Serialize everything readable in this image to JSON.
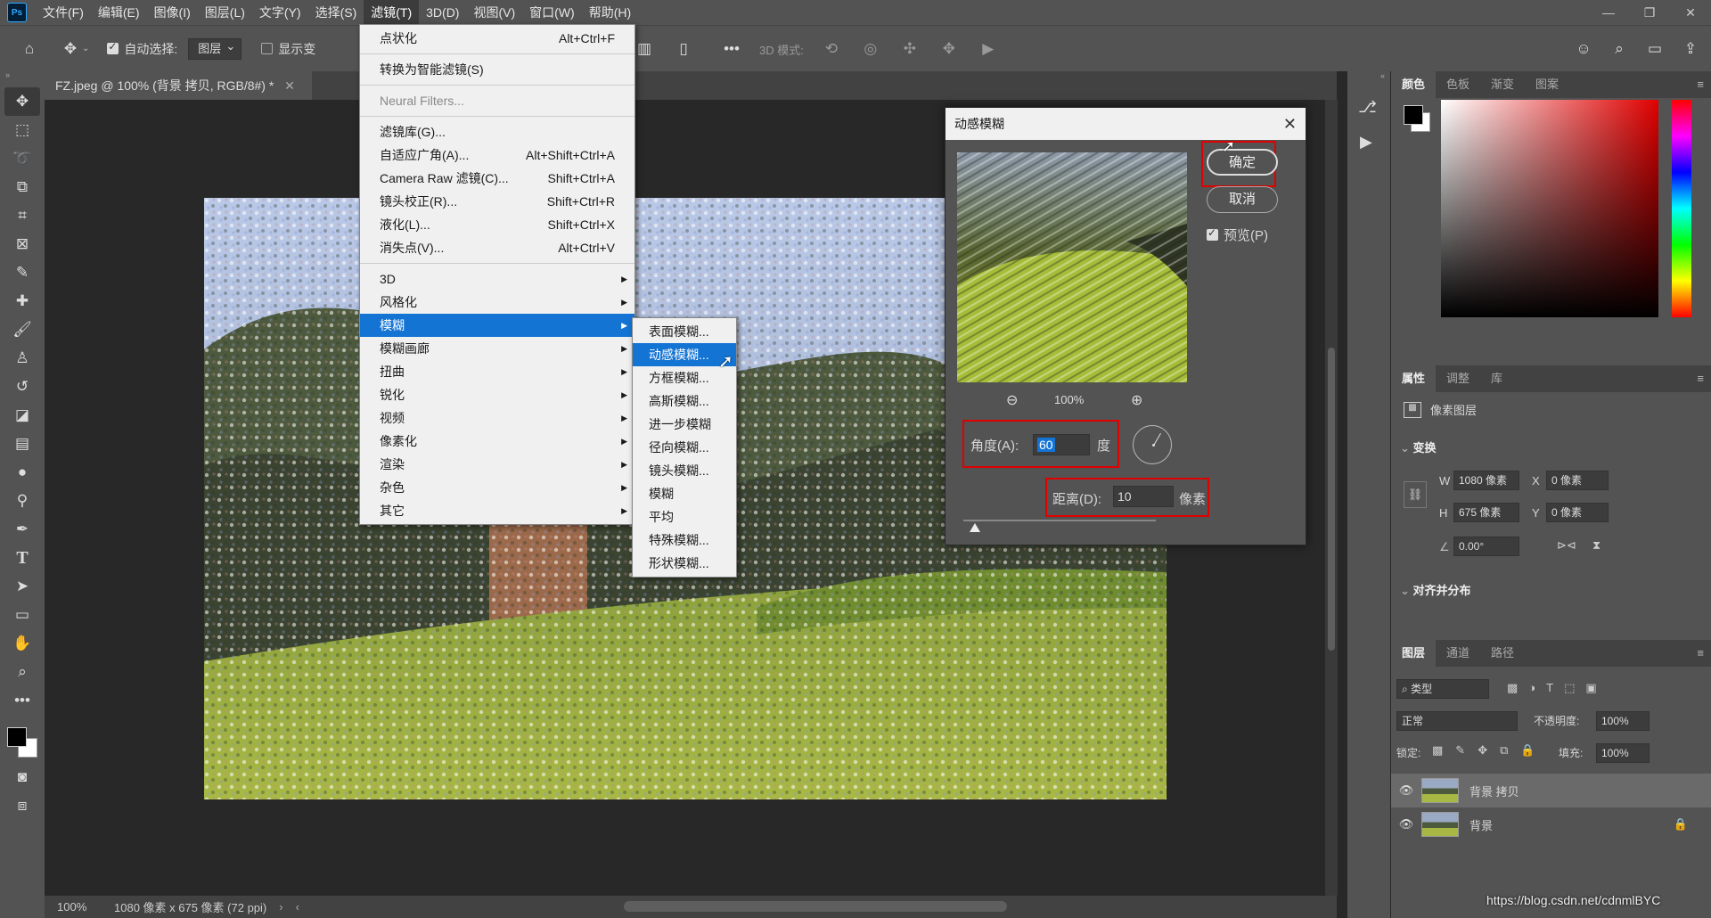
{
  "menubar": {
    "logo": "Ps",
    "items": [
      "文件(F)",
      "编辑(E)",
      "图像(I)",
      "图层(L)",
      "文字(Y)",
      "选择(S)",
      "滤镜(T)",
      "3D(D)",
      "视图(V)",
      "窗口(W)",
      "帮助(H)"
    ],
    "active_index": 6
  },
  "options_bar": {
    "auto_select_label": "自动选择:",
    "auto_select_value": "图层",
    "show_transform_label": "显示变",
    "mode_3d_label": "3D 模式:"
  },
  "document": {
    "tab_title": "FZ.jpeg @ 100% (背景 拷贝, RGB/8#) *",
    "zoom": "100%",
    "size_info": "1080 像素 x 675 像素 (72 ppi)"
  },
  "filter_menu": {
    "items": [
      {
        "label": "点状化",
        "shortcut": "Alt+Ctrl+F"
      },
      {
        "sep": true
      },
      {
        "label": "转换为智能滤镜(S)",
        "shortcut": ""
      },
      {
        "sep": true
      },
      {
        "label": "Neural Filters...",
        "shortcut": "",
        "disabled": true
      },
      {
        "sep": true
      },
      {
        "label": "滤镜库(G)...",
        "shortcut": ""
      },
      {
        "label": "自适应广角(A)...",
        "shortcut": "Alt+Shift+Ctrl+A"
      },
      {
        "label": "Camera Raw 滤镜(C)...",
        "shortcut": "Shift+Ctrl+A"
      },
      {
        "label": "镜头校正(R)...",
        "shortcut": "Shift+Ctrl+R"
      },
      {
        "label": "液化(L)...",
        "shortcut": "Shift+Ctrl+X"
      },
      {
        "label": "消失点(V)...",
        "shortcut": "Alt+Ctrl+V"
      },
      {
        "sep": true
      },
      {
        "label": "3D",
        "sub": true
      },
      {
        "label": "风格化",
        "sub": true
      },
      {
        "label": "模糊",
        "sub": true,
        "highlight": true
      },
      {
        "label": "模糊画廊",
        "sub": true
      },
      {
        "label": "扭曲",
        "sub": true
      },
      {
        "label": "锐化",
        "sub": true
      },
      {
        "label": "视频",
        "sub": true
      },
      {
        "label": "像素化",
        "sub": true
      },
      {
        "label": "渲染",
        "sub": true
      },
      {
        "label": "杂色",
        "sub": true
      },
      {
        "label": "其它",
        "sub": true
      }
    ]
  },
  "blur_submenu": {
    "items": [
      "表面模糊...",
      "动感模糊...",
      "方框模糊...",
      "高斯模糊...",
      "进一步模糊",
      "径向模糊...",
      "镜头模糊...",
      "模糊",
      "平均",
      "特殊模糊...",
      "形状模糊..."
    ],
    "highlight_index": 1
  },
  "dialog": {
    "title": "动感模糊",
    "ok": "确定",
    "cancel": "取消",
    "preview_label": "预览(P)",
    "zoom": "100%",
    "angle_label": "角度(A):",
    "angle_value": "60",
    "angle_unit": "度",
    "distance_label": "距离(D):",
    "distance_value": "10",
    "distance_unit": "像素"
  },
  "panels": {
    "color_tabs": [
      "颜色",
      "色板",
      "渐变",
      "图案"
    ],
    "props_tabs": [
      "属性",
      "调整",
      "库"
    ],
    "pixel_layer": "像素图层",
    "transform_title": "变换",
    "w_label": "W",
    "w_value": "1080 像素",
    "h_label": "H",
    "h_value": "675 像素",
    "x_label": "X",
    "x_value": "0 像素",
    "y_label": "Y",
    "y_value": "0 像素",
    "angle_value": "0.00°",
    "align_title": "对齐并分布",
    "layers_tabs": [
      "图层",
      "通道",
      "路径"
    ],
    "filter_kind": "类型",
    "blend_mode": "正常",
    "opacity_label": "不透明度:",
    "opacity_value": "100%",
    "lock_label": "锁定:",
    "fill_label": "填充:",
    "fill_value": "100%",
    "layers": [
      {
        "name": "背景 拷贝",
        "selected": true
      },
      {
        "name": "背景",
        "locked": true
      }
    ]
  },
  "watermark": "https://blog.csdn.net/cdnmlBYC"
}
